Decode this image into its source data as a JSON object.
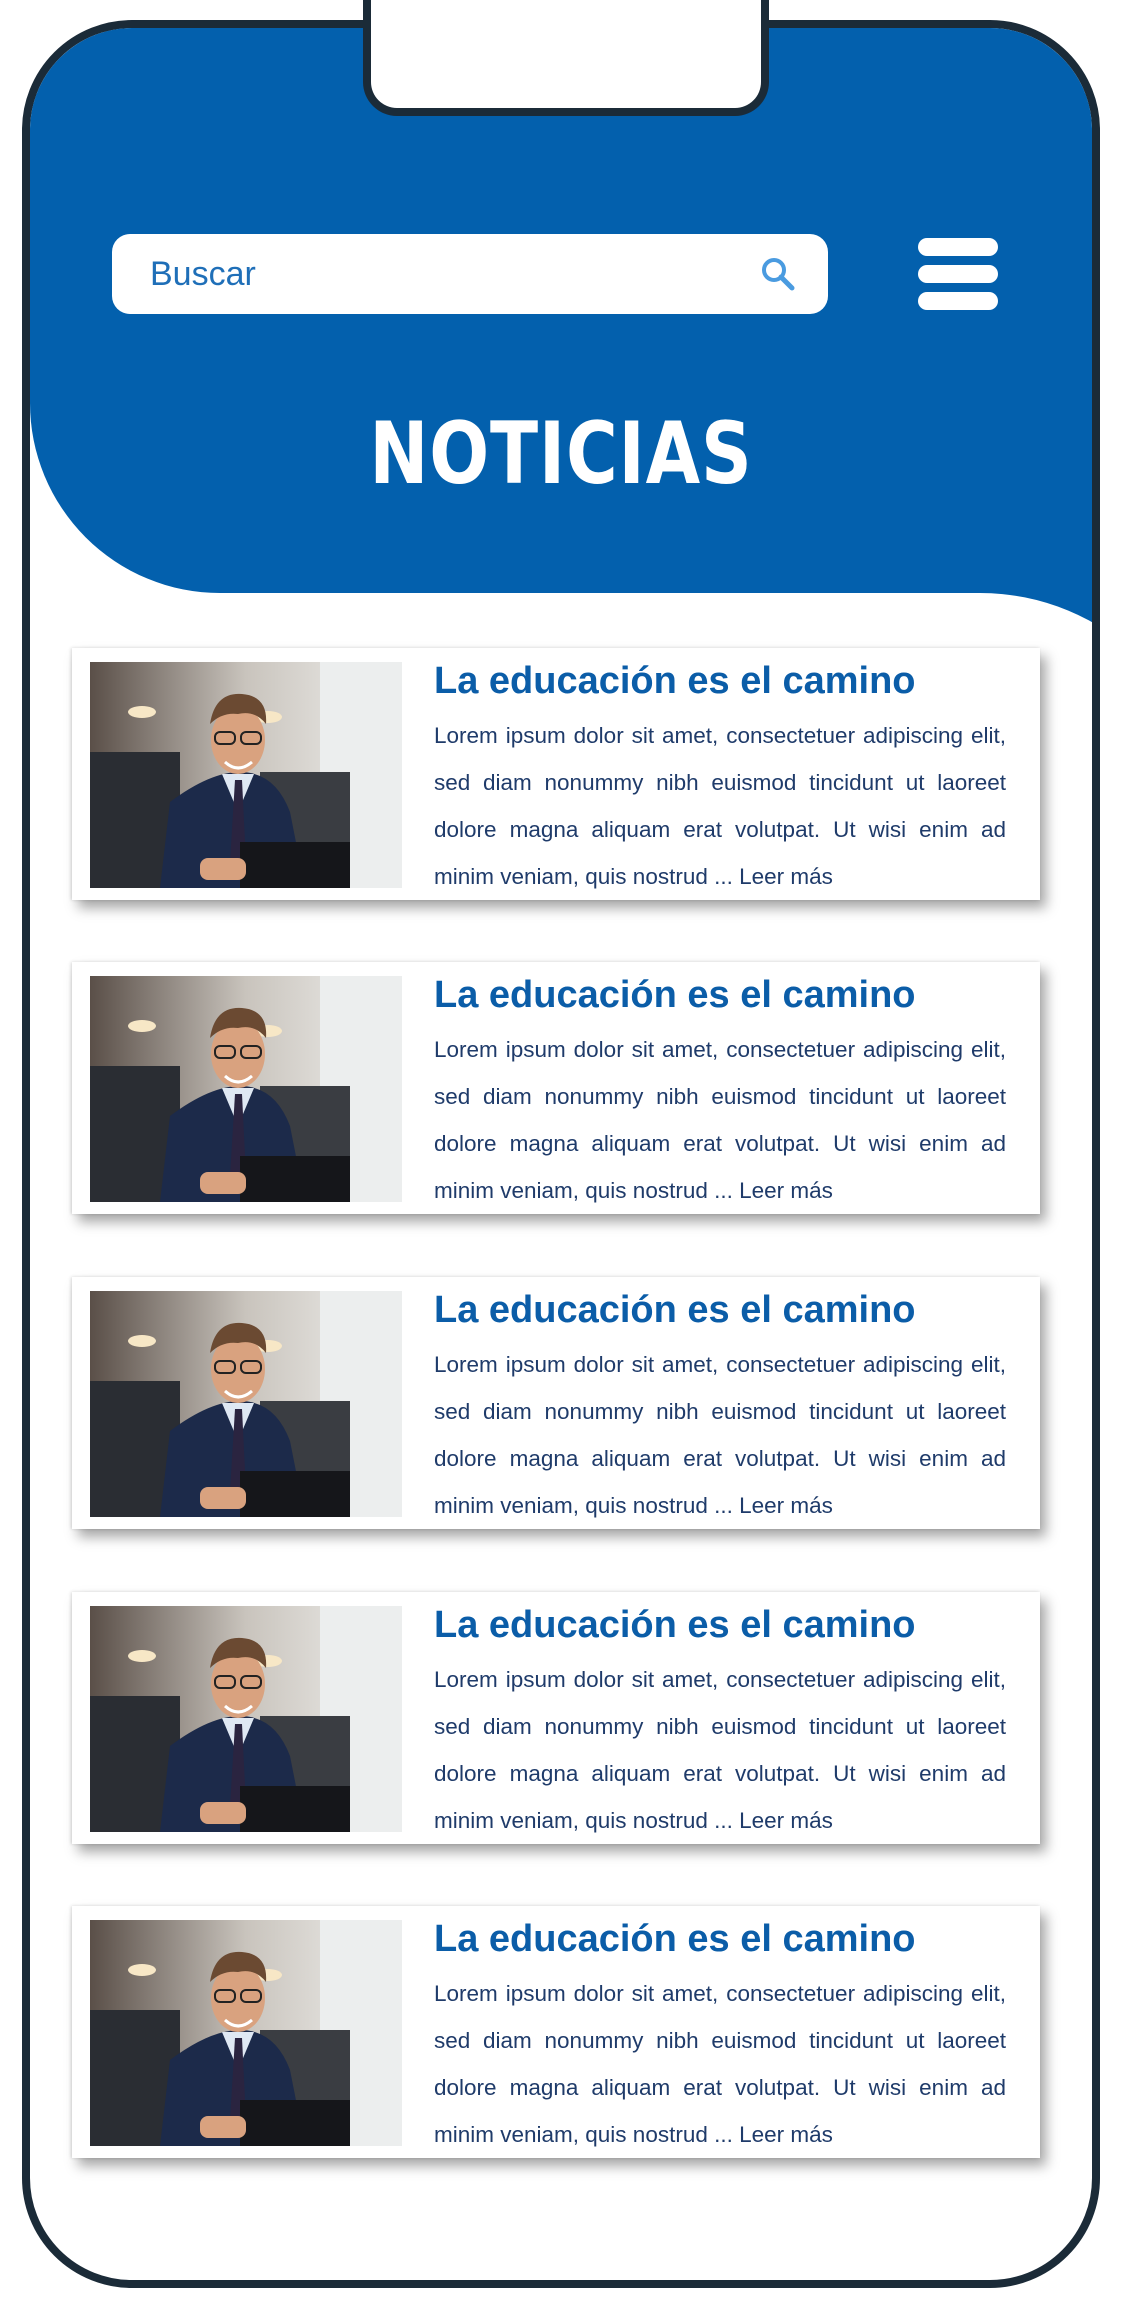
{
  "search": {
    "placeholder": "Buscar"
  },
  "header": {
    "title": "NOTICIAS"
  },
  "icons": {
    "search": "search-icon",
    "menu": "hamburger-menu-icon"
  },
  "colors": {
    "primary": "#0360ad",
    "title_text": "#0b5da8",
    "body_text": "#1f3b6a",
    "frame": "#1b2b38"
  },
  "news": [
    {
      "title": "La educación es el camino",
      "body": "Lorem ipsum dolor sit amet, consectetuer adipiscing elit, sed diam nonummy nibh euismod tincidunt ut laoreet dolore magna aliquam erat volutpat. Ut wisi enim ad minim veniam, quis nostrud ...",
      "read_more": "Leer más"
    },
    {
      "title": "La educación es el camino",
      "body": "Lorem ipsum dolor sit amet, consectetuer adipiscing elit, sed diam nonummy nibh euismod tincidunt ut laoreet dolore magna aliquam erat volutpat. Ut wisi enim ad minim veniam, quis nostrud ...",
      "read_more": "Leer más"
    },
    {
      "title": "La educación es el camino",
      "body": "Lorem ipsum dolor sit amet, consectetuer adipiscing elit, sed diam nonummy nibh euismod tincidunt ut laoreet dolore magna aliquam erat volutpat. Ut wisi enim ad minim veniam, quis nostrud ...",
      "read_more": "Leer más"
    },
    {
      "title": "La educación es el camino",
      "body": "Lorem ipsum dolor sit amet, consectetuer adipiscing elit, sed diam nonummy nibh euismod tincidunt ut laoreet dolore magna aliquam erat volutpat. Ut wisi enim ad minim veniam, quis nostrud ...",
      "read_more": "Leer más"
    },
    {
      "title": "La educación es el camino",
      "body": "Lorem ipsum dolor sit amet, consectetuer adipiscing elit, sed diam nonummy nibh euismod tincidunt ut laoreet dolore magna aliquam erat volutpat. Ut wisi enim ad minim veniam, quis nostrud ...",
      "read_more": "Leer más"
    }
  ]
}
